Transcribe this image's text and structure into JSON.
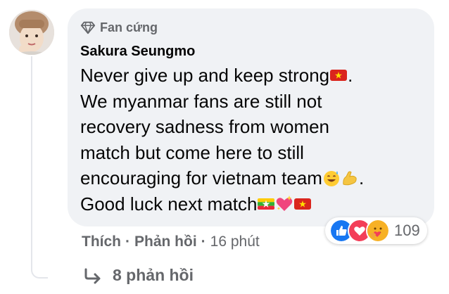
{
  "comment": {
    "badge_label": "Fan cứng",
    "badge_icon": "diamond-icon",
    "author": "Sakura Seungmo",
    "lines": [
      "Never give up and keep strong",
      "We myanmar fans are still not",
      "recovery sadness from women",
      "match but come here to still",
      "encouraging for vietnam team",
      "Good luck next match"
    ],
    "line_end_punctuation": [
      "."
    ],
    "line_five_end": ".",
    "emojis": [
      "vietnam-flag",
      "grinning-sweat",
      "flexed-biceps",
      "myanmar-flag",
      "sparkling-heart",
      "vietnam-flag"
    ]
  },
  "actions": {
    "like": "Thích",
    "separator": "·",
    "reply": "Phản hồi",
    "time": "16 phút"
  },
  "reactions": {
    "icons": [
      "like-reaction-icon",
      "love-reaction-icon",
      "care-reaction-icon"
    ],
    "count": "109"
  },
  "replies": {
    "icon": "reply-arrow-icon",
    "label": "8 phản hồi"
  },
  "colors": {
    "bubble": "#f0f2f5",
    "secondary_text": "#65676b",
    "primary_text": "#050505",
    "like_blue": "#1877f2",
    "love_red": "#f33e58",
    "care_yellow": "#f7b125"
  }
}
